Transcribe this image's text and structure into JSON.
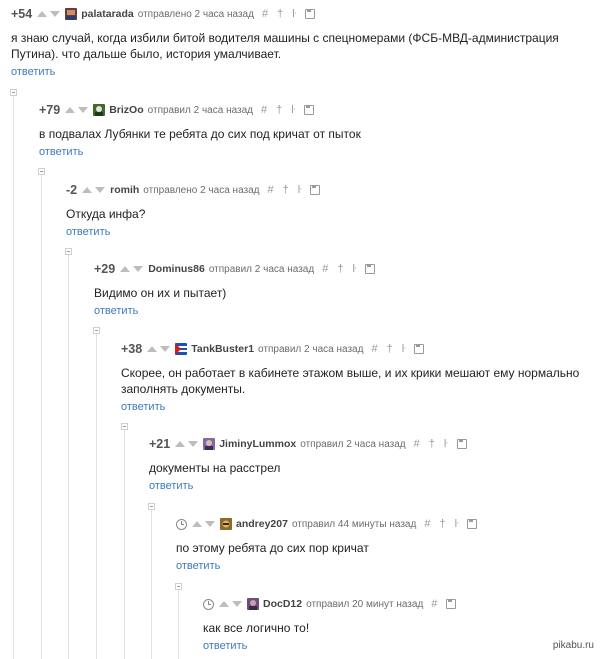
{
  "reply_label": "ответить",
  "watermark": "pikabu.ru",
  "comments": [
    {
      "rating": "+54",
      "user": "palatarada",
      "time": "отправлено 2 часа назад",
      "text": "я знаю случай, когда избили битой водителя машины с спецномерами (ФСБ-МВД-администрация Путина). что дальше было, история умалчивает."
    },
    {
      "rating": "+79",
      "user": "BrizOo",
      "time": "отправил 2 часа назад",
      "text": "в подвалах Лубянки те ребята до сих под кричат от пыток"
    },
    {
      "rating": "-2",
      "user": "romih",
      "time": "отправлено 2 часа назад",
      "text": "Откуда инфа?"
    },
    {
      "rating": "+29",
      "user": "Dominus86",
      "time": "отправил 2 часа назад",
      "text": "Видимо он их и пытает)"
    },
    {
      "rating": "+38",
      "user": "TankBuster1",
      "time": "отправил 2 часа назад",
      "text": "Скорее, он работает в кабинете этажом выше, и их крики мешают ему нормально заполнять документы."
    },
    {
      "rating": "+21",
      "user": "JiminyLummox",
      "time": "отправил 2 часа назад",
      "text": "документы на расстрел"
    },
    {
      "rating": "",
      "user": "andrey207",
      "time": "отправил 44 минуты назад",
      "text": "по этому ребята до сих пор кричат"
    },
    {
      "rating": "",
      "user": "DocD12",
      "time": "отправил 20 минут назад",
      "text": "как все логично то!"
    }
  ],
  "tool_icons": [
    "hash-icon",
    "pin-icon",
    "reply-arrow-icon",
    "save-icon"
  ],
  "colors": {
    "link": "#3c7abc",
    "rating": "#555555",
    "thread_line": "#e2e2e2"
  }
}
